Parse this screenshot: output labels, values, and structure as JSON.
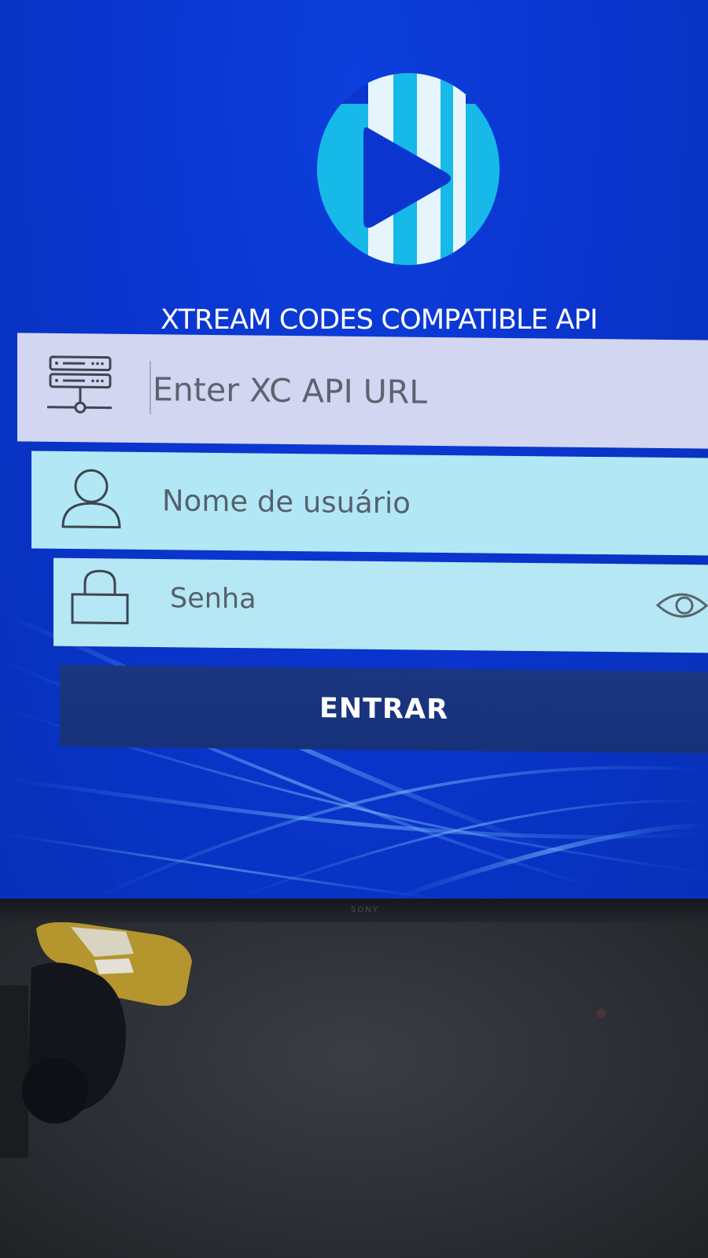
{
  "app": {
    "title": "XTREAM CODES COMPATIBLE API",
    "brand_color": "#0a35cf"
  },
  "login_form": {
    "url_field": {
      "placeholder": "Enter XC API URL",
      "value": "",
      "icon": "server-network-icon"
    },
    "username_field": {
      "placeholder": "Nome de usuário",
      "value": "",
      "icon": "user-icon"
    },
    "password_field": {
      "placeholder": "Senha",
      "value": "",
      "icon": "lock-icon",
      "toggle_icon": "eye-icon"
    },
    "submit_label": "ENTRAR"
  },
  "tv": {
    "brand": "SONY"
  }
}
